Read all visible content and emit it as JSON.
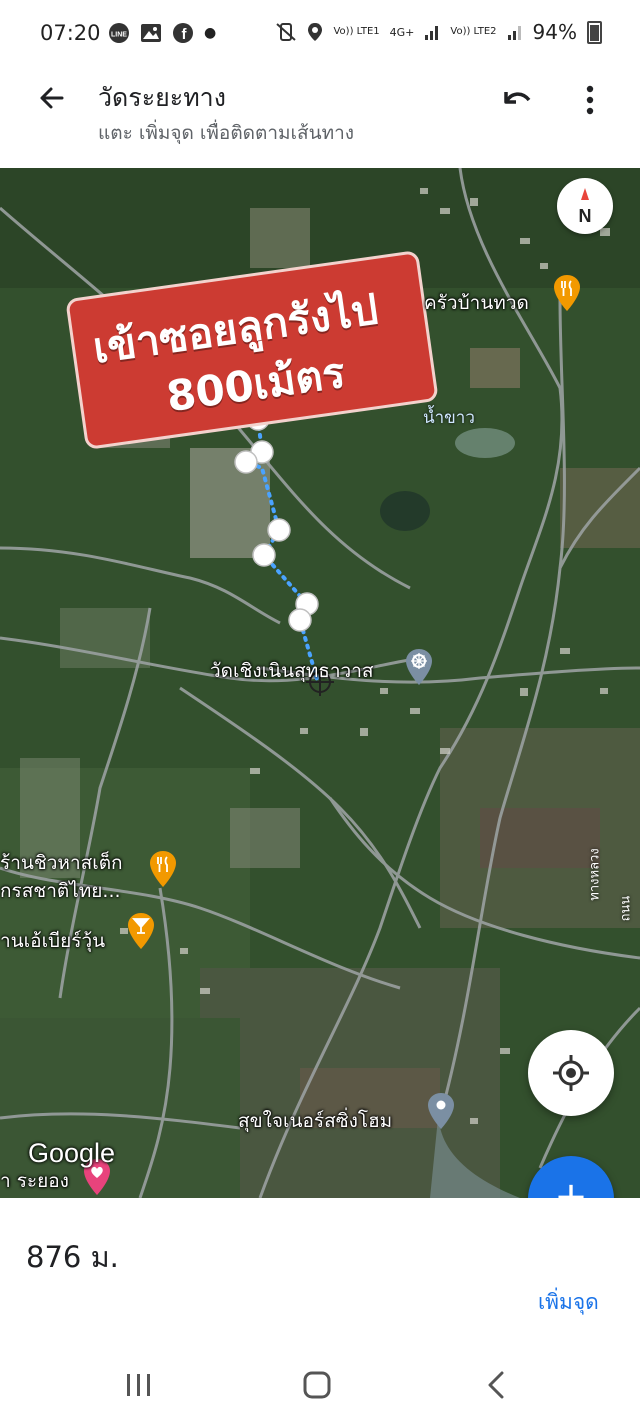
{
  "status": {
    "time": "07:20",
    "left_icons": [
      "line-icon",
      "image-icon",
      "facebook-icon",
      "dot-icon"
    ],
    "right_icons": [
      "mute-vibrate-icon",
      "location-icon",
      "signal-lte1-icon",
      "signal-lte2-icon"
    ],
    "lte1": "Vo)) LTE1",
    "net4g": "4G+",
    "lte2": "Vo)) LTE2",
    "battery": "94%"
  },
  "header": {
    "title": "วัดระยะทาง",
    "subtitle": "แตะ เพิ่มจุด เพื่อติดตามเส้นทาง",
    "back_icon": "arrow-back-icon",
    "undo_icon": "undo-icon",
    "more_icon": "more-vert-icon"
  },
  "map": {
    "compass_label": "N",
    "banner": {
      "line1": "เข้าซอยลูกรังไป",
      "line2": "800เม้ตร",
      "color": "#cc3b32"
    },
    "places": [
      {
        "name": "ครัวบ้านทวด",
        "icon": "restaurant-icon",
        "color": "#f29900"
      },
      {
        "name": "วัดเชิงเนินสุทธาวาส",
        "icon": "temple-icon",
        "color": "#7b8fa3"
      },
      {
        "name": "ร้านชิวหาสเต็ก",
        "name2": "กรสชาติไทย...",
        "icon": "restaurant-icon",
        "color": "#f29900"
      },
      {
        "name": "านเอ้เบียร์วุ้น",
        "icon": "bar-icon",
        "color": "#f29900"
      },
      {
        "name": "สุขใจเนอร์สซิ่งโฮม",
        "icon": "location-pin-icon",
        "color": "#7b8fa3"
      },
      {
        "name": "า ระยอง",
        "icon": "heart-pin-icon",
        "color": "#e8437c"
      }
    ],
    "water_label": "น้ำขาว",
    "road_labels": [
      "ทางหลวง",
      "ถนน"
    ],
    "google_logo": "Google",
    "route_color": "#4aa3ff"
  },
  "panel": {
    "distance": "876 ม.",
    "add_point_label": "เพิ่มจุด"
  },
  "navbar": {
    "icons": [
      "recent-apps-icon",
      "home-icon",
      "back-icon"
    ]
  }
}
